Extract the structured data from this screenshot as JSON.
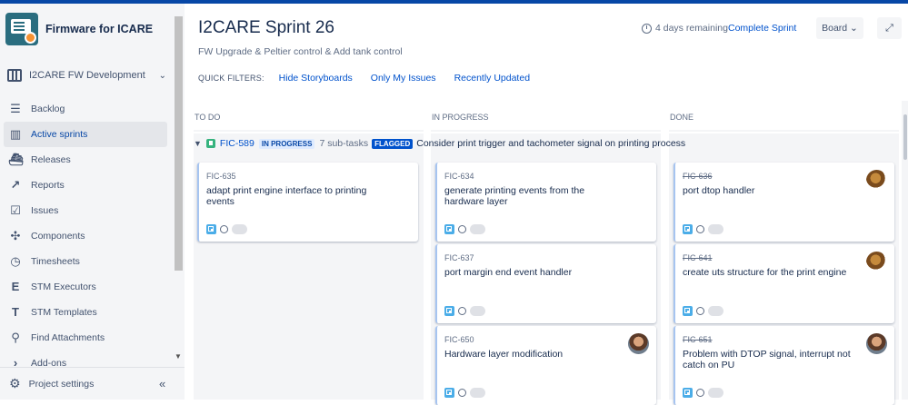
{
  "project": {
    "name": "Firmware for ICARE"
  },
  "board_selector": {
    "label": "I2CARE FW Development"
  },
  "nav": [
    {
      "label": "Backlog",
      "icon": "backlog-icon",
      "glyph": "☰"
    },
    {
      "label": "Active sprints",
      "icon": "board-icon",
      "glyph": "▥",
      "active": true
    },
    {
      "label": "Releases",
      "icon": "ship-icon",
      "glyph": "⛴"
    },
    {
      "label": "Reports",
      "icon": "chart-icon",
      "glyph": "↗"
    },
    {
      "label": "Issues",
      "icon": "issues-icon",
      "glyph": "☑"
    },
    {
      "label": "Components",
      "icon": "puzzle-icon",
      "glyph": "✣"
    },
    {
      "label": "Timesheets",
      "icon": "clock-icon",
      "glyph": "◷"
    },
    {
      "label": "STM Executors",
      "icon": "stm-e-icon",
      "glyph": "E"
    },
    {
      "label": "STM Templates",
      "icon": "stm-t-icon",
      "glyph": "T"
    },
    {
      "label": "Find Attachments",
      "icon": "search-icon",
      "glyph": "⚲"
    },
    {
      "label": "Add-ons",
      "icon": "chevron-right-icon",
      "glyph": "›"
    }
  ],
  "footer": {
    "settings_label": "Project settings",
    "collapse_glyph": "«"
  },
  "header": {
    "title": "I2CARE Sprint 26",
    "goal": "FW Upgrade & Peltier control & Add tank control",
    "remaining": "4 days remaining",
    "complete_label": "Complete Sprint",
    "board_label": "Board ⌄",
    "expand_glyph": "⤢"
  },
  "quick_filters": {
    "label": "QUICK FILTERS:",
    "items": [
      "Hide Storyboards",
      "Only My Issues",
      "Recently Updated"
    ]
  },
  "columns": [
    "TO DO",
    "IN PROGRESS",
    "DONE"
  ],
  "swimlane": {
    "key": "FIC-589",
    "status": "IN PROGRESS",
    "subtasks": "7 sub-tasks",
    "flag": "FLAGGED",
    "summary": "Consider print trigger and tachometer signal on printing process"
  },
  "cards": {
    "todo": [
      {
        "key": "FIC-635",
        "summary": "adapt print engine interface to printing events"
      }
    ],
    "inprogress": [
      {
        "key": "FIC-634",
        "summary": "generate printing events from the hardware layer"
      },
      {
        "key": "FIC-637",
        "summary": "port margin end event handler"
      },
      {
        "key": "FIC-650",
        "summary": "Hardware layer modification",
        "avatar": "person"
      }
    ],
    "done": [
      {
        "key": "FIC-636",
        "summary": "port dtop handler",
        "avatar": "squirrel"
      },
      {
        "key": "FIC-641",
        "summary": "create uts structure for the print engine",
        "avatar": "squirrel"
      },
      {
        "key": "FIC-651",
        "summary": "Problem with DTOP signal, interrupt not catch on PU",
        "avatar": "person"
      }
    ]
  }
}
